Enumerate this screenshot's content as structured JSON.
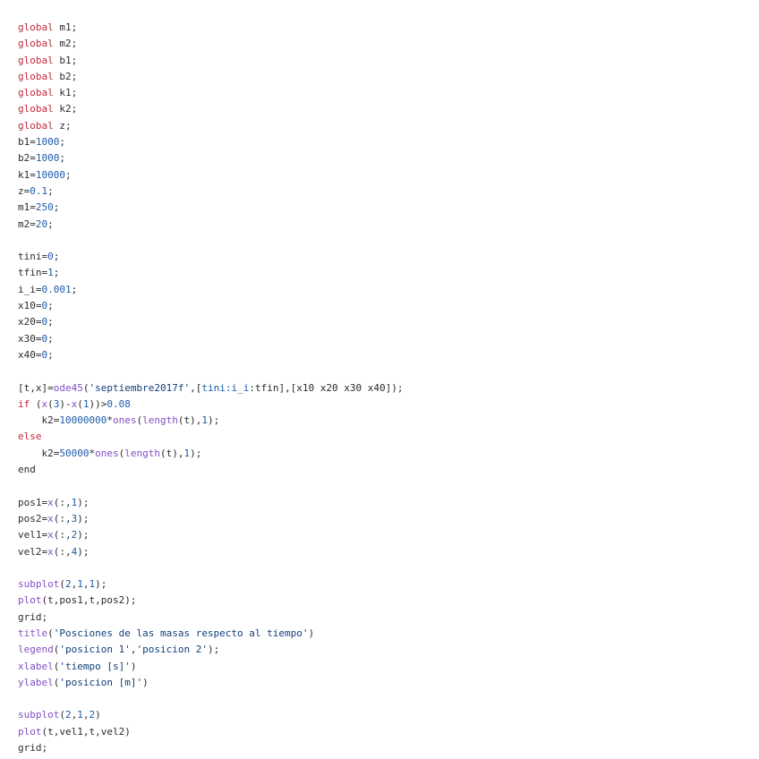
{
  "colors": {
    "keyword": "#c0283a",
    "number": "#1c5aa8",
    "function": "#8250c4",
    "string": "#123f7a",
    "plain": "#2b2b2b",
    "background": "#ffffff"
  },
  "lines": [
    [
      [
        "kw",
        "global"
      ],
      [
        "p",
        " m1;"
      ]
    ],
    [
      [
        "kw",
        "global"
      ],
      [
        "p",
        " m2;"
      ]
    ],
    [
      [
        "kw",
        "global"
      ],
      [
        "p",
        " b1;"
      ]
    ],
    [
      [
        "kw",
        "global"
      ],
      [
        "p",
        " b2;"
      ]
    ],
    [
      [
        "kw",
        "global"
      ],
      [
        "p",
        " k1;"
      ]
    ],
    [
      [
        "kw",
        "global"
      ],
      [
        "p",
        " k2;"
      ]
    ],
    [
      [
        "kw",
        "global"
      ],
      [
        "p",
        " z;"
      ]
    ],
    [
      [
        "p",
        "b1="
      ],
      [
        "num",
        "1000"
      ],
      [
        "p",
        ";"
      ]
    ],
    [
      [
        "p",
        "b2="
      ],
      [
        "num",
        "1000"
      ],
      [
        "p",
        ";"
      ]
    ],
    [
      [
        "p",
        "k1="
      ],
      [
        "num",
        "10000"
      ],
      [
        "p",
        ";"
      ]
    ],
    [
      [
        "p",
        "z="
      ],
      [
        "num",
        "0.1"
      ],
      [
        "p",
        ";"
      ]
    ],
    [
      [
        "p",
        "m1="
      ],
      [
        "num",
        "250"
      ],
      [
        "p",
        ";"
      ]
    ],
    [
      [
        "p",
        "m2="
      ],
      [
        "num",
        "20"
      ],
      [
        "p",
        ";"
      ]
    ],
    [],
    [
      [
        "p",
        "tini="
      ],
      [
        "num",
        "0"
      ],
      [
        "p",
        ";"
      ]
    ],
    [
      [
        "p",
        "tfin="
      ],
      [
        "num",
        "1"
      ],
      [
        "p",
        ";"
      ]
    ],
    [
      [
        "p",
        "i_i="
      ],
      [
        "num",
        "0.001"
      ],
      [
        "p",
        ";"
      ]
    ],
    [
      [
        "p",
        "x10="
      ],
      [
        "num",
        "0"
      ],
      [
        "p",
        ";"
      ]
    ],
    [
      [
        "p",
        "x20="
      ],
      [
        "num",
        "0"
      ],
      [
        "p",
        ";"
      ]
    ],
    [
      [
        "p",
        "x30="
      ],
      [
        "num",
        "0"
      ],
      [
        "p",
        ";"
      ]
    ],
    [
      [
        "p",
        "x40="
      ],
      [
        "num",
        "0"
      ],
      [
        "p",
        ";"
      ]
    ],
    [],
    [
      [
        "p",
        "[t,x]="
      ],
      [
        "fn",
        "ode45"
      ],
      [
        "p",
        "("
      ],
      [
        "str",
        "'septiembre2017f'"
      ],
      [
        "p",
        ",["
      ],
      [
        "var",
        "tini:i_i"
      ],
      [
        "p",
        ":tfin],[x10 x20 x30 x40]);"
      ]
    ],
    [
      [
        "kw",
        "if"
      ],
      [
        "p",
        " ("
      ],
      [
        "fn",
        "x"
      ],
      [
        "p",
        "("
      ],
      [
        "num",
        "3"
      ],
      [
        "p",
        ")-"
      ],
      [
        "fn",
        "x"
      ],
      [
        "p",
        "("
      ],
      [
        "num",
        "1"
      ],
      [
        "p",
        "))>"
      ],
      [
        "num",
        "0.08"
      ]
    ],
    [
      [
        "p",
        "    k2="
      ],
      [
        "num",
        "10000000"
      ],
      [
        "p",
        "*"
      ],
      [
        "fn",
        "ones"
      ],
      [
        "p",
        "("
      ],
      [
        "fn",
        "length"
      ],
      [
        "p",
        "(t),"
      ],
      [
        "num",
        "1"
      ],
      [
        "p",
        ");"
      ]
    ],
    [
      [
        "kw",
        "else"
      ]
    ],
    [
      [
        "p",
        "    k2="
      ],
      [
        "num",
        "50000"
      ],
      [
        "p",
        "*"
      ],
      [
        "fn",
        "ones"
      ],
      [
        "p",
        "("
      ],
      [
        "fn",
        "length"
      ],
      [
        "p",
        "(t),"
      ],
      [
        "num",
        "1"
      ],
      [
        "p",
        ");"
      ]
    ],
    [
      [
        "p",
        "end"
      ]
    ],
    [],
    [
      [
        "p",
        "pos1="
      ],
      [
        "fn",
        "x"
      ],
      [
        "p",
        "(:,"
      ],
      [
        "num",
        "1"
      ],
      [
        "p",
        ");"
      ]
    ],
    [
      [
        "p",
        "pos2="
      ],
      [
        "fn",
        "x"
      ],
      [
        "p",
        "(:,"
      ],
      [
        "num",
        "3"
      ],
      [
        "p",
        ");"
      ]
    ],
    [
      [
        "p",
        "vel1="
      ],
      [
        "fn",
        "x"
      ],
      [
        "p",
        "(:,"
      ],
      [
        "num",
        "2"
      ],
      [
        "p",
        ");"
      ]
    ],
    [
      [
        "p",
        "vel2="
      ],
      [
        "fn",
        "x"
      ],
      [
        "p",
        "(:,"
      ],
      [
        "num",
        "4"
      ],
      [
        "p",
        ");"
      ]
    ],
    [],
    [
      [
        "fn",
        "subplot"
      ],
      [
        "p",
        "("
      ],
      [
        "num",
        "2"
      ],
      [
        "p",
        ","
      ],
      [
        "num",
        "1"
      ],
      [
        "p",
        ","
      ],
      [
        "num",
        "1"
      ],
      [
        "p",
        ");"
      ]
    ],
    [
      [
        "fn",
        "plot"
      ],
      [
        "p",
        "(t,pos1,t,pos2);"
      ]
    ],
    [
      [
        "p",
        "grid;"
      ]
    ],
    [
      [
        "fn",
        "title"
      ],
      [
        "p",
        "("
      ],
      [
        "str",
        "'Posciones de las masas respecto al tiempo'"
      ],
      [
        "p",
        ")"
      ]
    ],
    [
      [
        "fn",
        "legend"
      ],
      [
        "p",
        "("
      ],
      [
        "str",
        "'posicion 1'"
      ],
      [
        "p",
        ","
      ],
      [
        "str",
        "'posicion 2'"
      ],
      [
        "p",
        ");"
      ]
    ],
    [
      [
        "fn",
        "xlabel"
      ],
      [
        "p",
        "("
      ],
      [
        "str",
        "'tiempo [s]'"
      ],
      [
        "p",
        ")"
      ]
    ],
    [
      [
        "fn",
        "ylabel"
      ],
      [
        "p",
        "("
      ],
      [
        "str",
        "'posicion [m]'"
      ],
      [
        "p",
        ")"
      ]
    ],
    [],
    [
      [
        "fn",
        "subplot"
      ],
      [
        "p",
        "("
      ],
      [
        "num",
        "2"
      ],
      [
        "p",
        ","
      ],
      [
        "num",
        "1"
      ],
      [
        "p",
        ","
      ],
      [
        "num",
        "2"
      ],
      [
        "p",
        ")"
      ]
    ],
    [
      [
        "fn",
        "plot"
      ],
      [
        "p",
        "(t,vel1,t,vel2)"
      ]
    ],
    [
      [
        "p",
        "grid;"
      ]
    ]
  ]
}
